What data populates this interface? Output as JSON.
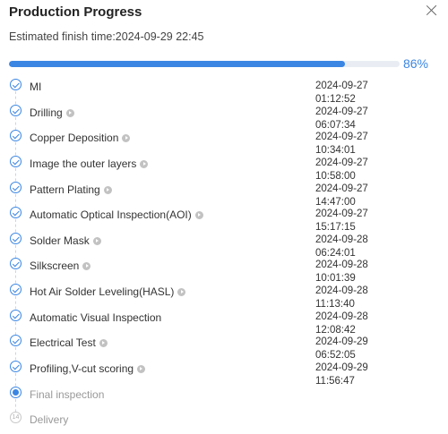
{
  "dialog": {
    "title": "Production Progress",
    "eta_label": "Estimated finish time:",
    "eta_value": "2024-09-29 22:45",
    "progress_percent": 86,
    "progress_text": "86%"
  },
  "colors": {
    "accent": "#3b86e3",
    "track": "#e9edf3",
    "pending": "#c8c8c8"
  },
  "steps": [
    {
      "name": "MI",
      "status": "done",
      "has_play": false,
      "date": "2024-09-27",
      "time": "01:12:52"
    },
    {
      "name": "Drilling",
      "status": "done",
      "has_play": true,
      "date": "2024-09-27",
      "time": "06:07:34"
    },
    {
      "name": "Copper Deposition",
      "status": "done",
      "has_play": true,
      "date": "2024-09-27",
      "time": "10:34:01"
    },
    {
      "name": "Image the outer layers",
      "status": "done",
      "has_play": true,
      "date": "2024-09-27",
      "time": "10:58:00"
    },
    {
      "name": "Pattern Plating",
      "status": "done",
      "has_play": true,
      "date": "2024-09-27",
      "time": "14:47:00"
    },
    {
      "name": "Automatic Optical Inspection(AOI)",
      "status": "done",
      "has_play": true,
      "date": "2024-09-27",
      "time": "15:17:15"
    },
    {
      "name": "Solder Mask",
      "status": "done",
      "has_play": true,
      "date": "2024-09-28",
      "time": "06:24:01"
    },
    {
      "name": "Silkscreen",
      "status": "done",
      "has_play": true,
      "date": "2024-09-28",
      "time": "10:01:39"
    },
    {
      "name": "Hot Air Solder Leveling(HASL)",
      "status": "done",
      "has_play": true,
      "date": "2024-09-28",
      "time": "11:13:40"
    },
    {
      "name": "Automatic Visual Inspection",
      "status": "done",
      "has_play": false,
      "date": "2024-09-28",
      "time": "12:08:42"
    },
    {
      "name": "Electrical Test",
      "status": "done",
      "has_play": true,
      "date": "2024-09-29",
      "time": "06:52:05"
    },
    {
      "name": "Profiling,V-cut scoring",
      "status": "done",
      "has_play": true,
      "date": "2024-09-29",
      "time": "11:56:47"
    },
    {
      "name": "Final inspection",
      "status": "current",
      "has_play": false,
      "date": "",
      "time": ""
    },
    {
      "name": "Delivery",
      "status": "pending",
      "has_play": false,
      "number": "14",
      "date": "",
      "time": ""
    }
  ]
}
